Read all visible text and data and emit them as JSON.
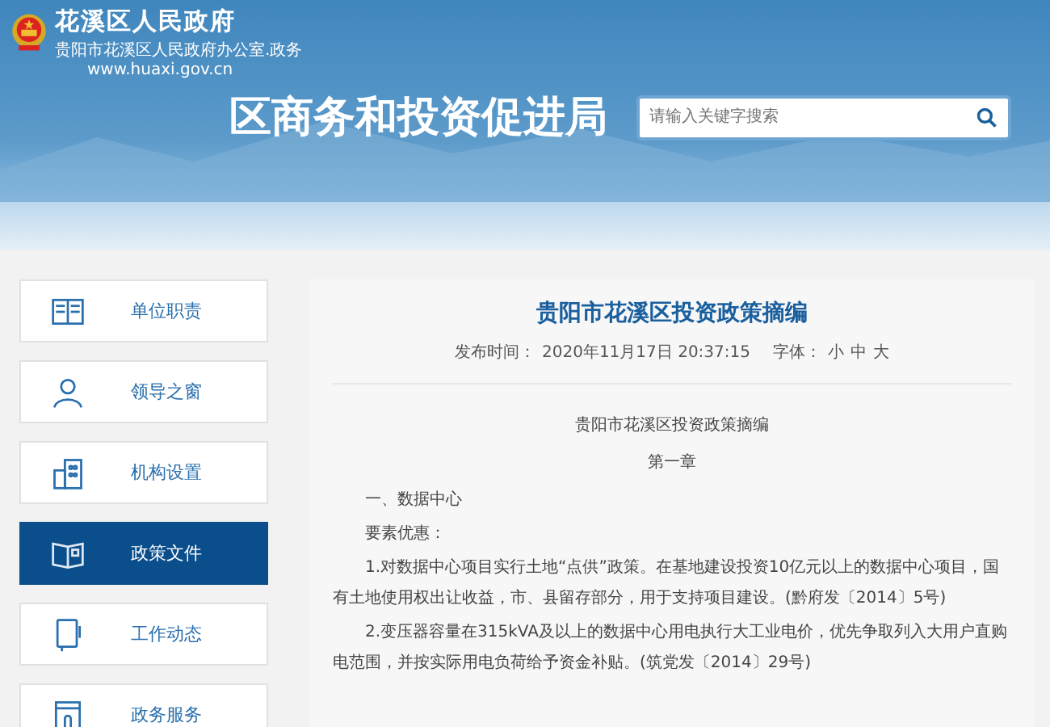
{
  "header": {
    "site_name": "花溪区人民政府",
    "site_subtitle": "贵阳市花溪区人民政府办公室.政务",
    "site_url": "www.huaxi.gov.cn",
    "department": "区商务和投资促进局",
    "search": {
      "placeholder": "请输入关键字搜索"
    }
  },
  "sidebar": {
    "items": [
      {
        "label": "单位职责",
        "selected": false
      },
      {
        "label": "领导之窗",
        "selected": false
      },
      {
        "label": "机构设置",
        "selected": false
      },
      {
        "label": "政策文件",
        "selected": true
      },
      {
        "label": "工作动态",
        "selected": false
      },
      {
        "label": "政务服务",
        "selected": false
      }
    ]
  },
  "article": {
    "title": "贵阳市花溪区投资政策摘编",
    "meta_label": "发布时间：",
    "published": "2020年11月17日 20:37:15",
    "font_label": "字体：",
    "font_sizes": [
      "小",
      "中",
      "大"
    ],
    "paragraphs": [
      {
        "kind": "center",
        "text": "贵阳市花溪区投资政策摘编"
      },
      {
        "kind": "center",
        "text": "第一章"
      },
      {
        "kind": "indent",
        "text": "一、数据中心"
      },
      {
        "kind": "indent",
        "text": "要素优惠："
      },
      {
        "kind": "indent",
        "text": "1.对数据中心项目实行土地“点供”政策。在基地建设投资10亿元以上的数据中心项目，国有土地使用权出让收益，市、县留存部分，用于支持项目建设。(黔府发〔2014〕5号)"
      },
      {
        "kind": "indent",
        "text": "2.变压器容量在315kVA及以上的数据中心用电执行大工业电价，优先争取列入大用户直购电范围，并按实际用电负荷给予资金补贴。(筑党发〔2014〕29号)"
      }
    ]
  }
}
